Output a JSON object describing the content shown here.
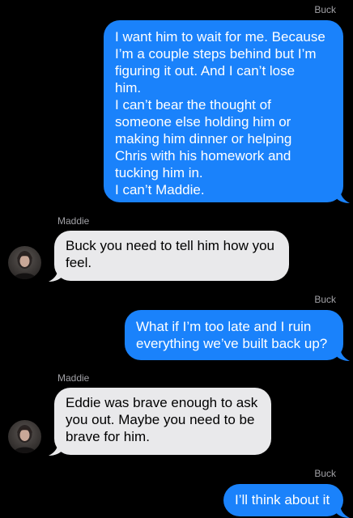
{
  "conversation": {
    "messages": [
      {
        "sender": "Buck",
        "direction": "outgoing",
        "text": "I want him to wait for me. Because\nI’m a couple steps behind but I’m\nfiguring it out. And I can’t lose\nhim.\nI can’t bear the thought of\nsomeone else holding him or\nmaking him dinner or helping\nChris with his homework and\ntucking him in.\nI can’t Maddie."
      },
      {
        "sender": "Maddie",
        "direction": "incoming",
        "text": "Buck you need to tell him how you\nfeel."
      },
      {
        "sender": "Buck",
        "direction": "outgoing",
        "text": "What if I’m too late and I ruin\neverything we’ve built back up?"
      },
      {
        "sender": "Maddie",
        "direction": "incoming",
        "text": "Eddie was brave enough to ask\nyou out. Maybe you need to be\nbrave for him."
      },
      {
        "sender": "Buck",
        "direction": "outgoing",
        "text": "I’ll think about it"
      }
    ]
  },
  "colors": {
    "background": "#000000",
    "outgoing_bubble": "#1a82fb",
    "incoming_bubble": "#e9e9eb",
    "sender_label": "#a1a1a6"
  },
  "icons": {
    "avatar": "contact-avatar-photo"
  }
}
